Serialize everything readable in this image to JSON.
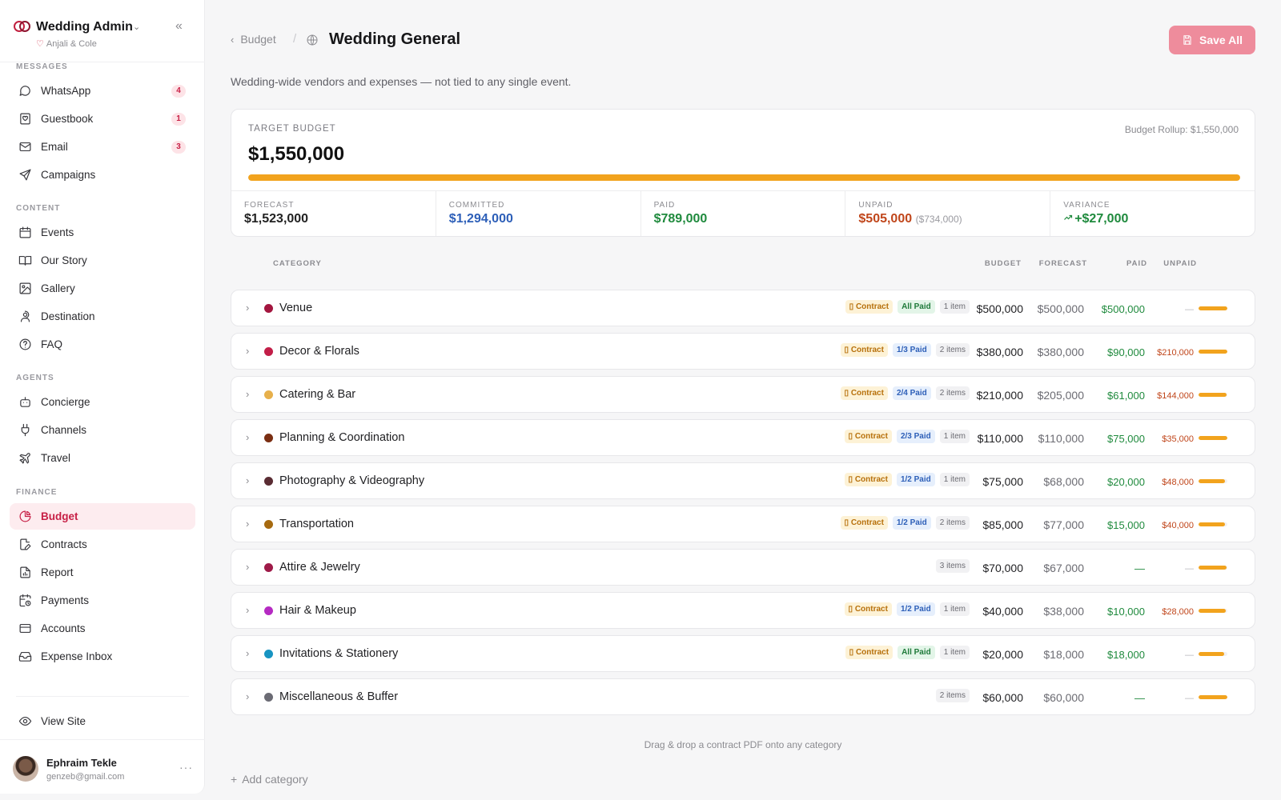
{
  "app": {
    "title": "Wedding Admin",
    "subtitle": "Anjali & Cole"
  },
  "sidebar": {
    "sections": [
      {
        "label": "MESSAGES",
        "items": [
          {
            "label": "WhatsApp",
            "icon": "chat-bubble-icon",
            "badge": "4"
          },
          {
            "label": "Guestbook",
            "icon": "guestbook-icon",
            "badge": "1"
          },
          {
            "label": "Email",
            "icon": "mail-icon",
            "badge": "3"
          },
          {
            "label": "Campaigns",
            "icon": "send-icon",
            "badge": ""
          }
        ]
      },
      {
        "label": "CONTENT",
        "items": [
          {
            "label": "Events",
            "icon": "calendar-icon"
          },
          {
            "label": "Our Story",
            "icon": "book-open-icon"
          },
          {
            "label": "Gallery",
            "icon": "image-icon"
          },
          {
            "label": "Destination",
            "icon": "map-pin-icon"
          },
          {
            "label": "FAQ",
            "icon": "help-circle-icon"
          }
        ]
      },
      {
        "label": "AGENTS",
        "items": [
          {
            "label": "Concierge",
            "icon": "bot-icon"
          },
          {
            "label": "Channels",
            "icon": "plug-icon"
          },
          {
            "label": "Travel",
            "icon": "plane-icon"
          }
        ]
      },
      {
        "label": "FINANCE",
        "items": [
          {
            "label": "Budget",
            "icon": "pie-chart-icon",
            "active": true
          },
          {
            "label": "Contracts",
            "icon": "file-edit-icon"
          },
          {
            "label": "Report",
            "icon": "file-chart-icon"
          },
          {
            "label": "Payments",
            "icon": "calendar-clock-icon"
          },
          {
            "label": "Accounts",
            "icon": "credit-card-icon"
          },
          {
            "label": "Expense Inbox",
            "icon": "inbox-icon"
          }
        ]
      }
    ],
    "view_site": "View Site",
    "user": {
      "name": "Ephraim Tekle",
      "email": "genzeb@gmail.com"
    }
  },
  "header": {
    "breadcrumb": "Budget",
    "title": "Wedding General",
    "save_label": "Save All",
    "subtitle": "Wedding-wide vendors and expenses — not tied to any single event."
  },
  "summary": {
    "target_label": "TARGET BUDGET",
    "target_value": "$1,550,000",
    "rollup": "Budget Rollup: $1,550,000",
    "progress_fraction": 1.0,
    "accent_color": "#f2a31d",
    "stats": [
      {
        "label": "FORECAST",
        "value": "$1,523,000",
        "sub": "",
        "color": "#222222"
      },
      {
        "label": "COMMITTED",
        "value": "$1,294,000",
        "sub": "",
        "color": "#2d5fb8"
      },
      {
        "label": "PAID",
        "value": "$789,000",
        "sub": "",
        "color": "#1f8a3d"
      },
      {
        "label": "UNPAID",
        "value": "$505,000",
        "sub": "($734,000)",
        "color": "#c0461b"
      },
      {
        "label": "VARIANCE",
        "value": "+$27,000",
        "sub": "",
        "color": "#1f8a3d",
        "icon": "trending-up-icon"
      }
    ]
  },
  "table": {
    "headers": {
      "category": "CATEGORY",
      "budget": "BUDGET",
      "forecast": "FORECAST",
      "paid": "PAID",
      "unpaid": "UNPAID"
    },
    "rows": [
      {
        "name": "Venue",
        "color": "#a3163f",
        "contract": "Contract",
        "status": "All Paid",
        "status_type": "allpaid",
        "items": "1 item",
        "budget": "$500,000",
        "forecast": "$500,000",
        "paid": "$500,000",
        "unpaid": "—",
        "progress": 1.0
      },
      {
        "name": "Decor & Florals",
        "color": "#c21e48",
        "contract": "Contract",
        "status": "1/3 Paid",
        "status_type": "partial",
        "items": "2 items",
        "budget": "$380,000",
        "forecast": "$380,000",
        "paid": "$90,000",
        "unpaid": "$210,000",
        "progress": 1.0
      },
      {
        "name": "Catering & Bar",
        "color": "#e7b04b",
        "contract": "Contract",
        "status": "2/4 Paid",
        "status_type": "partial",
        "items": "2 items",
        "budget": "$210,000",
        "forecast": "$205,000",
        "paid": "$61,000",
        "unpaid": "$144,000",
        "progress": 0.98
      },
      {
        "name": "Planning & Coordination",
        "color": "#7a2e12",
        "contract": "Contract",
        "status": "2/3 Paid",
        "status_type": "partial",
        "items": "1 item",
        "budget": "$110,000",
        "forecast": "$110,000",
        "paid": "$75,000",
        "unpaid": "$35,000",
        "progress": 1.0
      },
      {
        "name": "Photography & Videography",
        "color": "#5a2c33",
        "contract": "Contract",
        "status": "1/2 Paid",
        "status_type": "partial",
        "items": "1 item",
        "budget": "$75,000",
        "forecast": "$68,000",
        "paid": "$20,000",
        "unpaid": "$48,000",
        "progress": 0.91
      },
      {
        "name": "Transportation",
        "color": "#a66a10",
        "contract": "Contract",
        "status": "1/2 Paid",
        "status_type": "partial",
        "items": "2 items",
        "budget": "$85,000",
        "forecast": "$77,000",
        "paid": "$15,000",
        "unpaid": "$40,000",
        "progress": 0.91
      },
      {
        "name": "Attire & Jewelry",
        "color": "#9e1a48",
        "contract": "",
        "status": "",
        "status_type": "",
        "items": "3 items",
        "budget": "$70,000",
        "forecast": "$67,000",
        "paid": "—",
        "unpaid": "—",
        "progress": 0.96
      },
      {
        "name": "Hair & Makeup",
        "color": "#b52ac2",
        "contract": "Contract",
        "status": "1/2 Paid",
        "status_type": "partial",
        "items": "1 item",
        "budget": "$40,000",
        "forecast": "$38,000",
        "paid": "$10,000",
        "unpaid": "$28,000",
        "progress": 0.95
      },
      {
        "name": "Invitations & Stationery",
        "color": "#1794c2",
        "contract": "Contract",
        "status": "All Paid",
        "status_type": "allpaid",
        "items": "1 item",
        "budget": "$20,000",
        "forecast": "$18,000",
        "paid": "$18,000",
        "unpaid": "—",
        "progress": 0.9
      },
      {
        "name": "Miscellaneous & Buffer",
        "color": "#6b6b74",
        "contract": "",
        "status": "",
        "status_type": "",
        "items": "2 items",
        "budget": "$60,000",
        "forecast": "$60,000",
        "paid": "—",
        "unpaid": "—",
        "progress": 1.0
      }
    ]
  },
  "footer": {
    "drop_hint": "Drag & drop a contract PDF onto any category",
    "add_category": "Add category"
  }
}
